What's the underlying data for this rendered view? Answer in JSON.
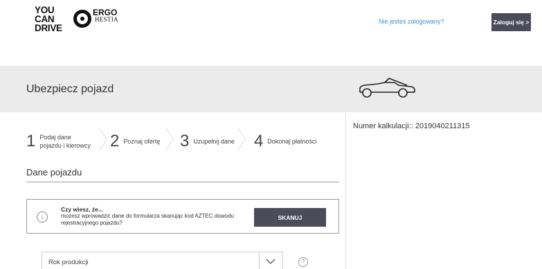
{
  "header": {
    "logo": {
      "line1": "YOU",
      "line2": "CAN",
      "line3": "DRIVE",
      "brand": "ERGO",
      "sub": "HESTIA"
    },
    "status_link": "Nie jesteś zalogowany?",
    "login_button": "Zaloguj się >"
  },
  "banner": {
    "title": "Ubezpiecz pojazd",
    "icon": "car-icon"
  },
  "steps": [
    {
      "number": "1",
      "label_line1": "Podaj dane",
      "label_line2": "pojazdu i kierowcy"
    },
    {
      "number": "2",
      "label_line1": "Poznaj ofertę",
      "label_line2": ""
    },
    {
      "number": "3",
      "label_line1": "Uzupełnij dane",
      "label_line2": ""
    },
    {
      "number": "4",
      "label_line1": "Dokonaj płatności",
      "label_line2": ""
    }
  ],
  "section": {
    "title": "Dane pojazdu",
    "info": {
      "heading": "Czy wiesz, że...",
      "text": "możesz wprowadzić dane do formularza skanując kod AZTEC dowodu rejestracyjnego pojazdu?",
      "icon_glyph": "i",
      "scan_button": "SKANUJ"
    },
    "production_year": {
      "label": "Rok produkcji",
      "help_glyph": "?"
    }
  },
  "sidebar": {
    "calc_number": "Numer kalkulacji:: 2019040211315"
  },
  "colors": {
    "button_bg": "#4b4c5a",
    "link": "#3d8fd1",
    "banner_bg": "#ebebeb"
  }
}
